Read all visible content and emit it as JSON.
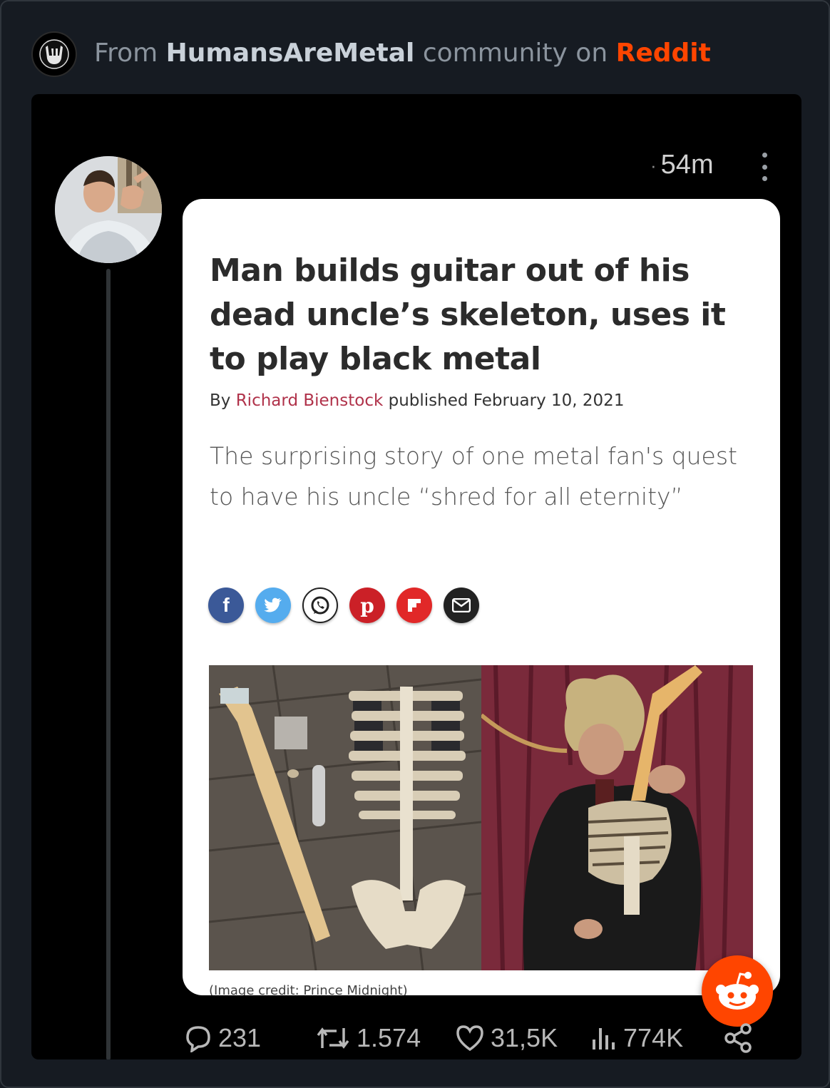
{
  "header": {
    "prefix": "From",
    "community": "HumansAreMetal",
    "middle": "community on",
    "brand": "Reddit",
    "brand_color": "#ff4500",
    "logo_icon": "rock-horns-icon"
  },
  "post": {
    "time": "54m",
    "avatar_icon": "user-avatar",
    "article": {
      "headline": "Man builds guitar out of his dead uncle’s skeleton, uses it to play black metal",
      "byline_prefix": "By",
      "author": "Richard Bienstock",
      "published_prefix": "published",
      "date": "February 10, 2021",
      "dek": "The surprising story of one metal fan's quest to have his uncle “shred for all eternity”",
      "share_icons": [
        "facebook-icon",
        "twitter-icon",
        "whatsapp-icon",
        "pinterest-icon",
        "flipboard-icon",
        "email-icon"
      ],
      "credit": "(Image credit: Prince Midnight)"
    },
    "actions": {
      "replies": "231",
      "reposts": "1.574",
      "likes": "31,5K",
      "views": "774K"
    }
  }
}
